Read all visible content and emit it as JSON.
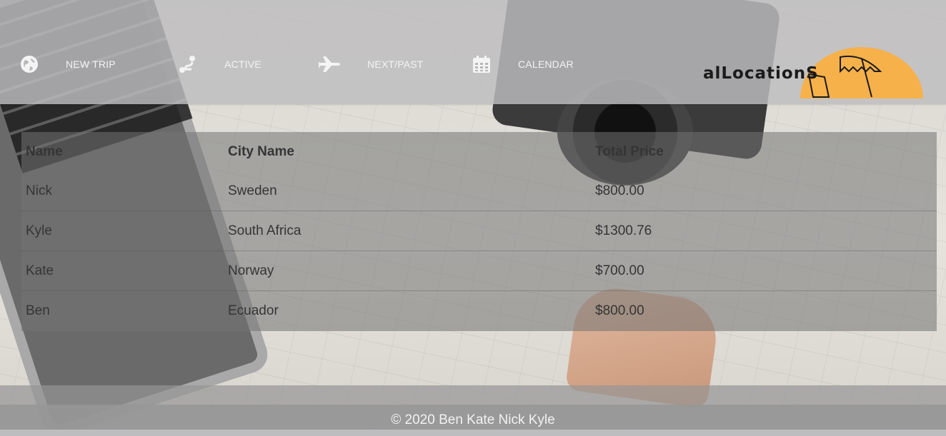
{
  "nav": [
    {
      "icon": "globe-icon",
      "label": "NEW TRIP"
    },
    {
      "icon": "route-icon",
      "label": "ACTIVE"
    },
    {
      "icon": "plane-icon",
      "label": "NEXT/PAST"
    },
    {
      "icon": "calendar-icon",
      "label": "CALENDAR"
    }
  ],
  "logo": {
    "text": "alLocationS",
    "accent": "#f6b14b"
  },
  "table": {
    "headers": [
      "Name",
      "City Name",
      "Total Price"
    ],
    "rows": [
      [
        "Nick",
        "Sweden",
        "$800.00"
      ],
      [
        "Kyle",
        "South Africa",
        "$1300.76"
      ],
      [
        "Kate",
        "Norway",
        "$700.00"
      ],
      [
        "Ben",
        "Ecuador",
        "$800.00"
      ]
    ]
  },
  "footer": {
    "text": "© 2020 Ben Kate Nick Kyle"
  }
}
